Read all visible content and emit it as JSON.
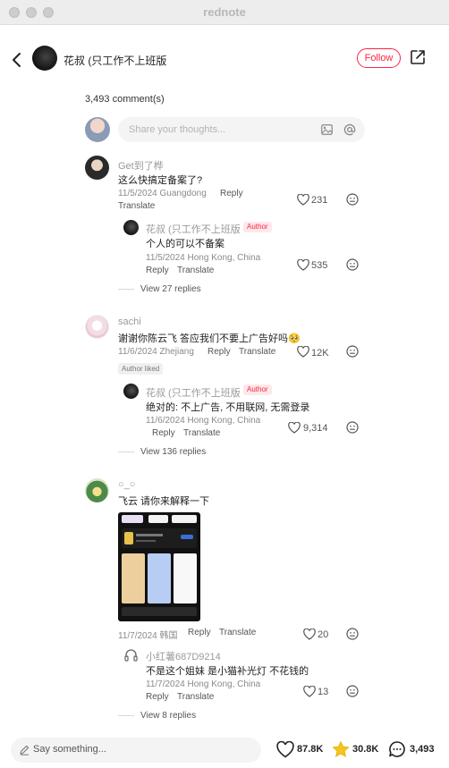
{
  "window": {
    "title": "rednote"
  },
  "header": {
    "author_name": "花叔 (只工作不上班版",
    "follow_label": "Follow"
  },
  "comments_section": {
    "count_label": "3,493 comment(s)",
    "input_placeholder": "Share your thoughts..."
  },
  "comments": [
    {
      "user": "Get到了桦",
      "text": "这么快搞定备案了?",
      "meta": "11/5/2024 Guangdong",
      "reply_label": "Reply",
      "translate_label": "Translate",
      "likes": "231",
      "reply": {
        "user": "花叔 (只工作不上班版",
        "badge": "Author",
        "text": "个人的可以不备案",
        "meta": "11/5/2024 Hong Kong, China",
        "reply_label": "Reply",
        "translate_label": "Translate",
        "likes": "535"
      },
      "view_replies": "View 27 replies"
    },
    {
      "user": "sachi",
      "text": "谢谢你陈云飞 答应我们不要上广告好吗🥺",
      "meta": "11/6/2024 Zhejiang",
      "reply_label": "Reply",
      "translate_label": "Translate",
      "likes": "12K",
      "author_liked": "Author liked",
      "reply": {
        "user": "花叔 (只工作不上班版",
        "badge": "Author",
        "text": "绝对的: 不上广告, 不用联网, 无需登录",
        "meta": "11/6/2024 Hong Kong, China",
        "reply_label": "Reply",
        "translate_label": "Translate",
        "likes": "9,314"
      },
      "view_replies": "View 136 replies"
    },
    {
      "user": "○_○",
      "text": "飞云 请你来解释一下",
      "meta": "11/7/2024 韩国",
      "reply_label": "Reply",
      "translate_label": "Translate",
      "likes": "20",
      "reply": {
        "user": "小红薯687D9214",
        "text": "不是这个姐妹 是小猫补光灯 不花钱的",
        "meta": "11/7/2024 Hong Kong, China",
        "reply_label": "Reply",
        "translate_label": "Translate",
        "likes": "13"
      },
      "view_replies": "View 8 replies"
    }
  ],
  "bottom_bar": {
    "say_placeholder": "Say something...",
    "likes": "87.8K",
    "collects": "30.8K",
    "comments": "3,493"
  },
  "colors": {
    "accent": "#ff2442",
    "star": "#f5c518"
  }
}
